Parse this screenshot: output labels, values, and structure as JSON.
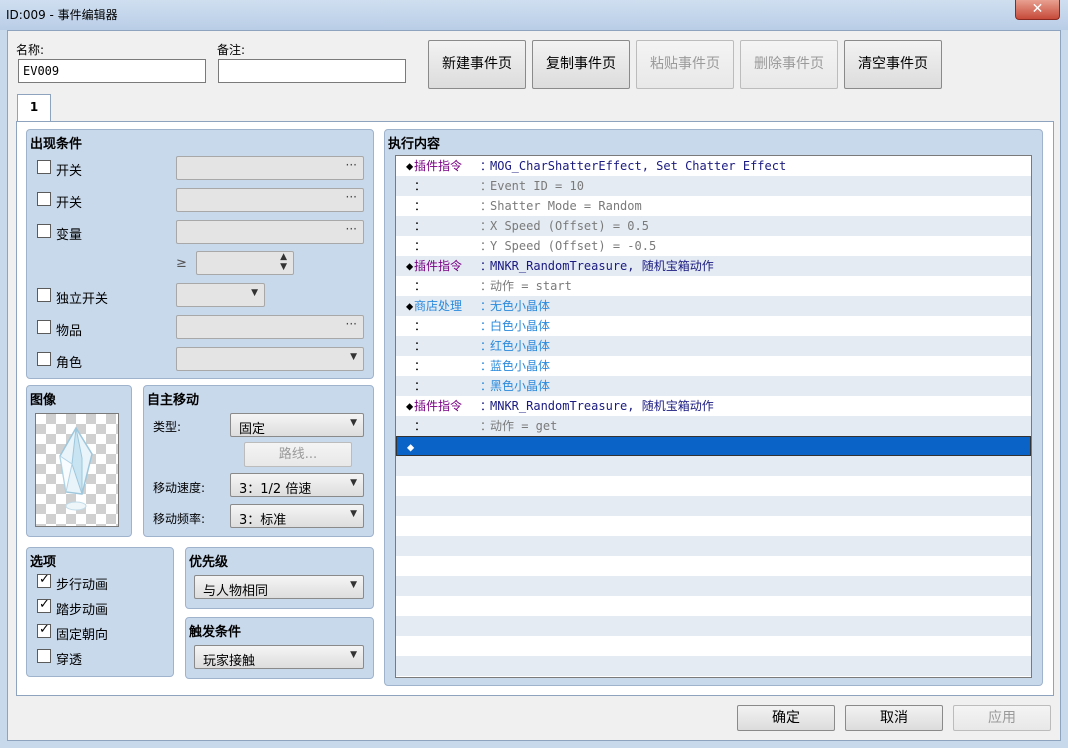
{
  "window": {
    "title": "ID:009 - 事件编辑器",
    "close_label": "✕"
  },
  "header": {
    "name_label": "名称:",
    "name_value": "EV009",
    "note_label": "备注:",
    "note_value": "",
    "buttons": [
      "新建事件页",
      "复制事件页",
      "粘贴事件页",
      "删除事件页",
      "清空事件页"
    ]
  },
  "tab": {
    "label": "1"
  },
  "conditions": {
    "title": "出现条件",
    "items": [
      "开关",
      "开关",
      "变量",
      "独立开关",
      "物品",
      "角色"
    ],
    "ge_symbol": "≥",
    "dots": "···"
  },
  "image": {
    "title": "图像"
  },
  "autonomous": {
    "title": "自主移动",
    "type_label": "类型:",
    "type_value": "固定",
    "route_button": "路线...",
    "speed_label": "移动速度:",
    "speed_value": "3：1/2 倍速",
    "freq_label": "移动频率:",
    "freq_value": "3：标准"
  },
  "options": {
    "title": "选项",
    "items": [
      {
        "label": "步行动画",
        "checked": true
      },
      {
        "label": "踏步动画",
        "checked": true
      },
      {
        "label": "固定朝向",
        "checked": true
      },
      {
        "label": "穿透",
        "checked": false
      }
    ]
  },
  "priority": {
    "title": "优先级",
    "value": "与人物相同"
  },
  "trigger": {
    "title": "触发条件",
    "value": "玩家接触"
  },
  "contents": {
    "title": "执行内容",
    "rows": [
      {
        "a": "◆",
        "b": "插件指令",
        "c": "：",
        "d": "MOG_CharShatterEffect, Set Chatter Effect",
        "style": "plugin"
      },
      {
        "a": " ",
        "b": "：",
        "c": "：",
        "d": "Event ID = 10",
        "style": "gray"
      },
      {
        "a": " ",
        "b": "：",
        "c": "：",
        "d": "Shatter Mode = Random",
        "style": "gray"
      },
      {
        "a": " ",
        "b": "：",
        "c": "：",
        "d": "X Speed (Offset) = 0.5",
        "style": "gray"
      },
      {
        "a": " ",
        "b": "：",
        "c": "：",
        "d": "Y Speed (Offset) = -0.5",
        "style": "gray"
      },
      {
        "a": "◆",
        "b": "插件指令",
        "c": "：",
        "d": "MNKR_RandomTreasure, 随机宝箱动作",
        "style": "plugin"
      },
      {
        "a": " ",
        "b": "：",
        "c": "：",
        "d": "动作 = start",
        "style": "gray"
      },
      {
        "a": "◆",
        "b": "商店处理",
        "c": "：",
        "d": "无色小晶体",
        "style": "shop"
      },
      {
        "a": " ",
        "b": "：",
        "c": "：",
        "d": "白色小晶体",
        "style": "shopsub"
      },
      {
        "a": " ",
        "b": "：",
        "c": "：",
        "d": "红色小晶体",
        "style": "shopsub"
      },
      {
        "a": " ",
        "b": "：",
        "c": "：",
        "d": "蓝色小晶体",
        "style": "shopsub"
      },
      {
        "a": " ",
        "b": "：",
        "c": "：",
        "d": "黑色小晶体",
        "style": "shopsub"
      },
      {
        "a": "◆",
        "b": "插件指令",
        "c": "：",
        "d": "MNKR_RandomTreasure, 随机宝箱动作",
        "style": "plugin"
      },
      {
        "a": " ",
        "b": "：",
        "c": "：",
        "d": "动作 = get",
        "style": "gray"
      },
      {
        "a": "◆",
        "b": "",
        "c": "",
        "d": "",
        "style": "selected"
      }
    ]
  },
  "footer": {
    "ok": "确定",
    "cancel": "取消",
    "apply": "应用"
  }
}
